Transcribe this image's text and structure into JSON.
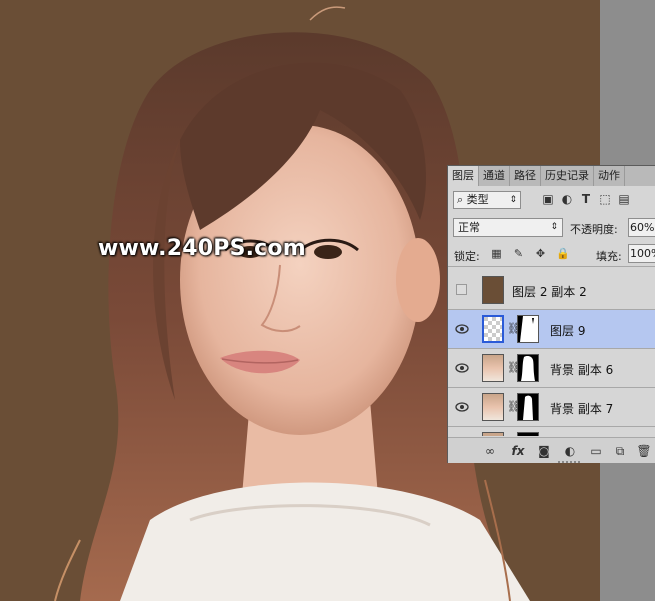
{
  "watermark": "www.240PS.com",
  "panel": {
    "tabs": [
      "图层",
      "通道",
      "路径",
      "历史记录",
      "动作"
    ],
    "active_tab": "图层",
    "filter_kind": "类型",
    "blend_mode": "正常",
    "opacity_label": "不透明度:",
    "opacity_value": "60%",
    "lock_label": "锁定:",
    "fill_label": "填充:",
    "fill_value": "100%",
    "layers": [
      {
        "name": "图层 2 副本 2",
        "visible": false,
        "selected": false,
        "thumb_color": "#6a4e36"
      },
      {
        "name": "图层 9",
        "visible": true,
        "selected": true
      },
      {
        "name": "背景 副本 6",
        "visible": true,
        "selected": false
      },
      {
        "name": "背景 副本 7",
        "visible": true,
        "selected": false
      }
    ]
  },
  "colors": {
    "canvas_bg": "#6a4e36",
    "selection": "#b5c7f0",
    "panel_bg": "#d6d6d6"
  }
}
